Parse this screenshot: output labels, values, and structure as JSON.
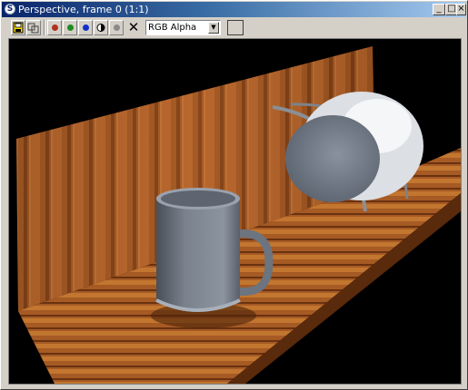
{
  "window": {
    "title": "Perspective, frame 0 (1:1)",
    "app_icon_glyph": "S",
    "minimize_glyph": "_",
    "maximize_glyph": "□",
    "close_glyph": "×"
  },
  "toolbar": {
    "icons": [
      "save-image-icon",
      "clone-window-icon",
      "red-channel-icon",
      "green-channel-icon",
      "blue-channel-icon",
      "alpha-channel-icon",
      "monochrome-icon",
      "clear-icon"
    ],
    "channel_select": {
      "value": "RGB Alpha"
    },
    "clear_glyph": "✕",
    "colors": {
      "red": "#b03020",
      "green": "#208a20",
      "blue": "#1030c8",
      "grey": "#8a8a8a"
    }
  },
  "viewport": {
    "background": "#000000",
    "content": "rendered-3d-scene"
  }
}
